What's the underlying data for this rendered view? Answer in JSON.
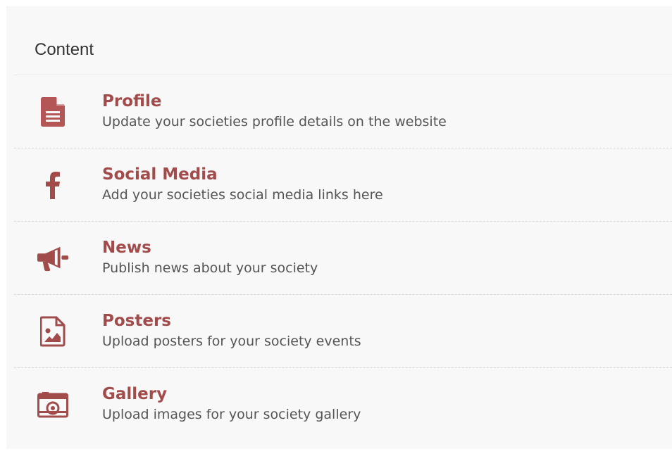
{
  "panel": {
    "title": "Content"
  },
  "items": [
    {
      "title": "Profile",
      "description": "Update your societies profile details on the website",
      "icon": "document-icon"
    },
    {
      "title": "Social Media",
      "description": "Add your societies social media links here",
      "icon": "facebook-icon"
    },
    {
      "title": "News",
      "description": "Publish news about your society",
      "icon": "megaphone-icon"
    },
    {
      "title": "Posters",
      "description": "Upload posters for your society events",
      "icon": "image-file-icon"
    },
    {
      "title": "Gallery",
      "description": "Upload images for your society gallery",
      "icon": "camera-icon"
    }
  ],
  "colors": {
    "accent": "#a24b4b",
    "panel_bg": "#f8f8f8",
    "text": "#555555"
  }
}
